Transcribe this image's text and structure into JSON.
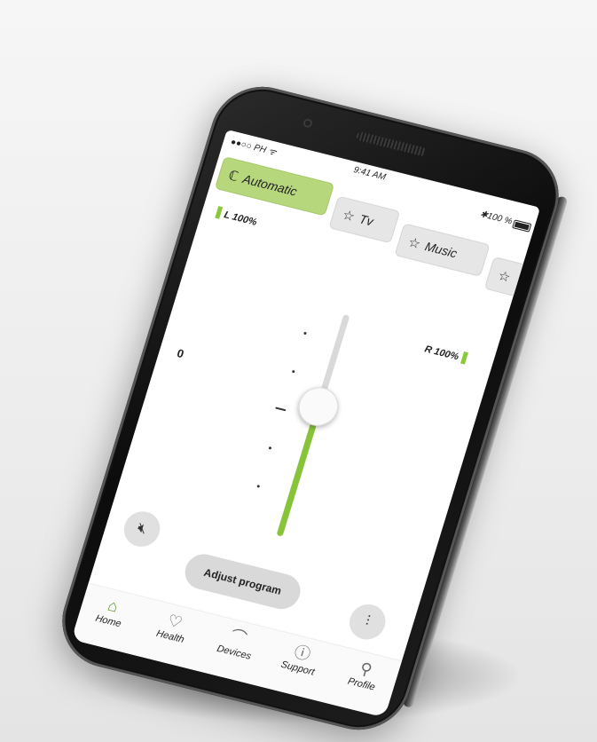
{
  "status_bar": {
    "carrier": "●●○○ PH ᯤ",
    "time": "9:41 AM",
    "battery": "✱100 %"
  },
  "programs": [
    {
      "label": "Automatic",
      "icon": "ear-icon",
      "active": true
    },
    {
      "label": "Tv",
      "icon": "star-icon",
      "active": false
    },
    {
      "label": "Music",
      "icon": "star-icon",
      "active": false
    }
  ],
  "left_battery": "L 100%",
  "right_battery": "R 100%",
  "volume_label": "0",
  "volume_level": 0.55,
  "buttons": {
    "adjust_program": "Adjust program"
  },
  "nav": [
    {
      "label": "Home",
      "icon": "home-icon",
      "active": true
    },
    {
      "label": "Health",
      "icon": "heart-icon",
      "active": false
    },
    {
      "label": "Devices",
      "icon": "hearing-aid-icon",
      "active": false
    },
    {
      "label": "Support",
      "icon": "help-icon",
      "active": false
    },
    {
      "label": "Profile",
      "icon": "person-icon",
      "active": false
    }
  ],
  "colors": {
    "accent": "#88c43a",
    "active_tab": "#b7d77d"
  }
}
